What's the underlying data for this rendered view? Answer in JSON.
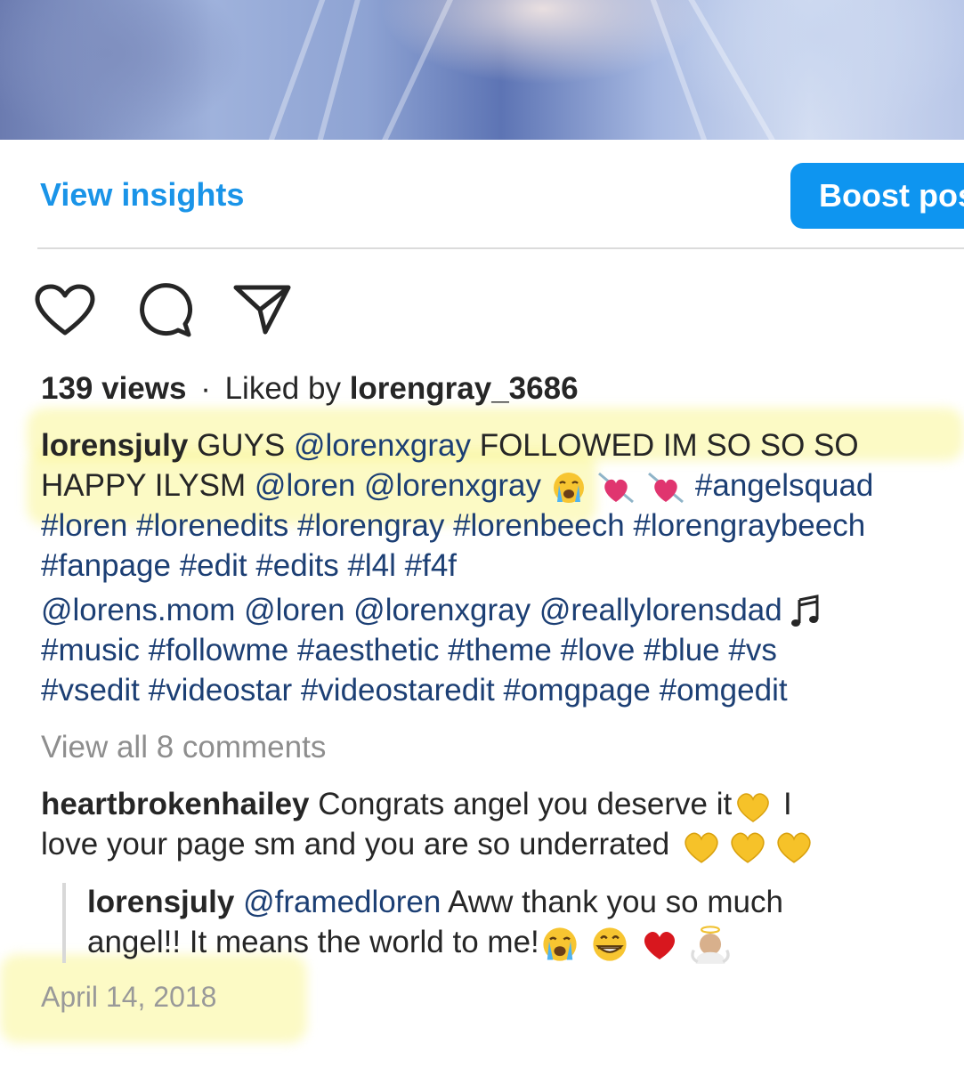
{
  "post": {
    "insights_label": "View insights",
    "boost_label": "Boost post"
  },
  "stats": {
    "views": "139 views",
    "separator": "·",
    "liked_by_prefix": "Liked by",
    "liked_by_user": "lorengray_3686"
  },
  "caption": {
    "username": "lorensjuly",
    "t1": "GUYS",
    "m1": "@lorenxgray",
    "t2": "FOLLOWED IM SO SO SO",
    "t3": "HAPPY ILYSM",
    "m2": "@loren",
    "m3": "@lorenxgray",
    "h1": "#angelsquad",
    "line3": "#loren #lorenedits  #lorengray #lorenbeech #lorengraybeech",
    "line4": "#fanpage #edit #edits #l4l #f4f",
    "line5": "@lorens.mom @loren @lorenxgray @reallylorensdad",
    "line6": "#music #followme #aesthetic #theme #love #blue #vs",
    "line7": "#vsedit #videostar #videostaredit #omgpage #omgedit"
  },
  "comments": {
    "view_all": "View all 8 comments",
    "c1_user": "heartbrokenhailey",
    "c1_text_a": "Congrats angel you deserve it",
    "c1_text_b": "I",
    "c1_text_c": "love your page sm and you are so underrated",
    "r1_user": "lorensjuly",
    "r1_mention": "@framedloren",
    "r1_text_a": "Aww thank you so much",
    "r1_text_b": "angel!! It means the world to me!"
  },
  "date": "April 14, 2018",
  "icons": [
    "heart-icon",
    "comment-icon",
    "share-icon",
    "music-note-icon",
    "crying-emoji",
    "heart-arrow-emoji",
    "yellow-heart-emoji",
    "grin-emoji",
    "red-heart-emoji",
    "angel-emoji"
  ],
  "colors": {
    "link": "#1c3f74",
    "accent": "#0e95f0",
    "highlight": "#faf596"
  }
}
